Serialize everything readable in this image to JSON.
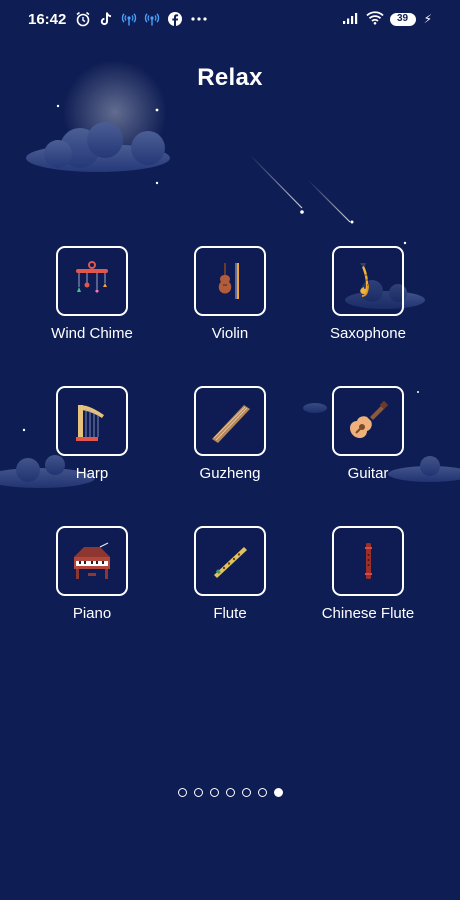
{
  "status_bar": {
    "time": "16:42",
    "battery": "39",
    "left_icons": [
      "alarm-icon",
      "tiktok-icon",
      "radio-icon",
      "radio-icon",
      "facebook-icon",
      "more-icon"
    ],
    "right_icons": [
      "signal-icon",
      "wifi-icon",
      "battery-icon",
      "charging-icon"
    ]
  },
  "page": {
    "title": "Relax"
  },
  "instruments": [
    {
      "label": "Wind Chime",
      "icon": "wind-chime-icon"
    },
    {
      "label": "Violin",
      "icon": "violin-icon"
    },
    {
      "label": "Saxophone",
      "icon": "saxophone-icon"
    },
    {
      "label": "Harp",
      "icon": "harp-icon"
    },
    {
      "label": "Guzheng",
      "icon": "guzheng-icon"
    },
    {
      "label": "Guitar",
      "icon": "guitar-icon"
    },
    {
      "label": "Piano",
      "icon": "piano-icon"
    },
    {
      "label": "Flute",
      "icon": "flute-icon"
    },
    {
      "label": "Chinese Flute",
      "icon": "chinese-flute-icon"
    }
  ],
  "pager": {
    "total": 7,
    "active": 7
  },
  "colors": {
    "background": "#0e1d54",
    "text": "#ffffff",
    "moon": "#fdf6d8"
  }
}
